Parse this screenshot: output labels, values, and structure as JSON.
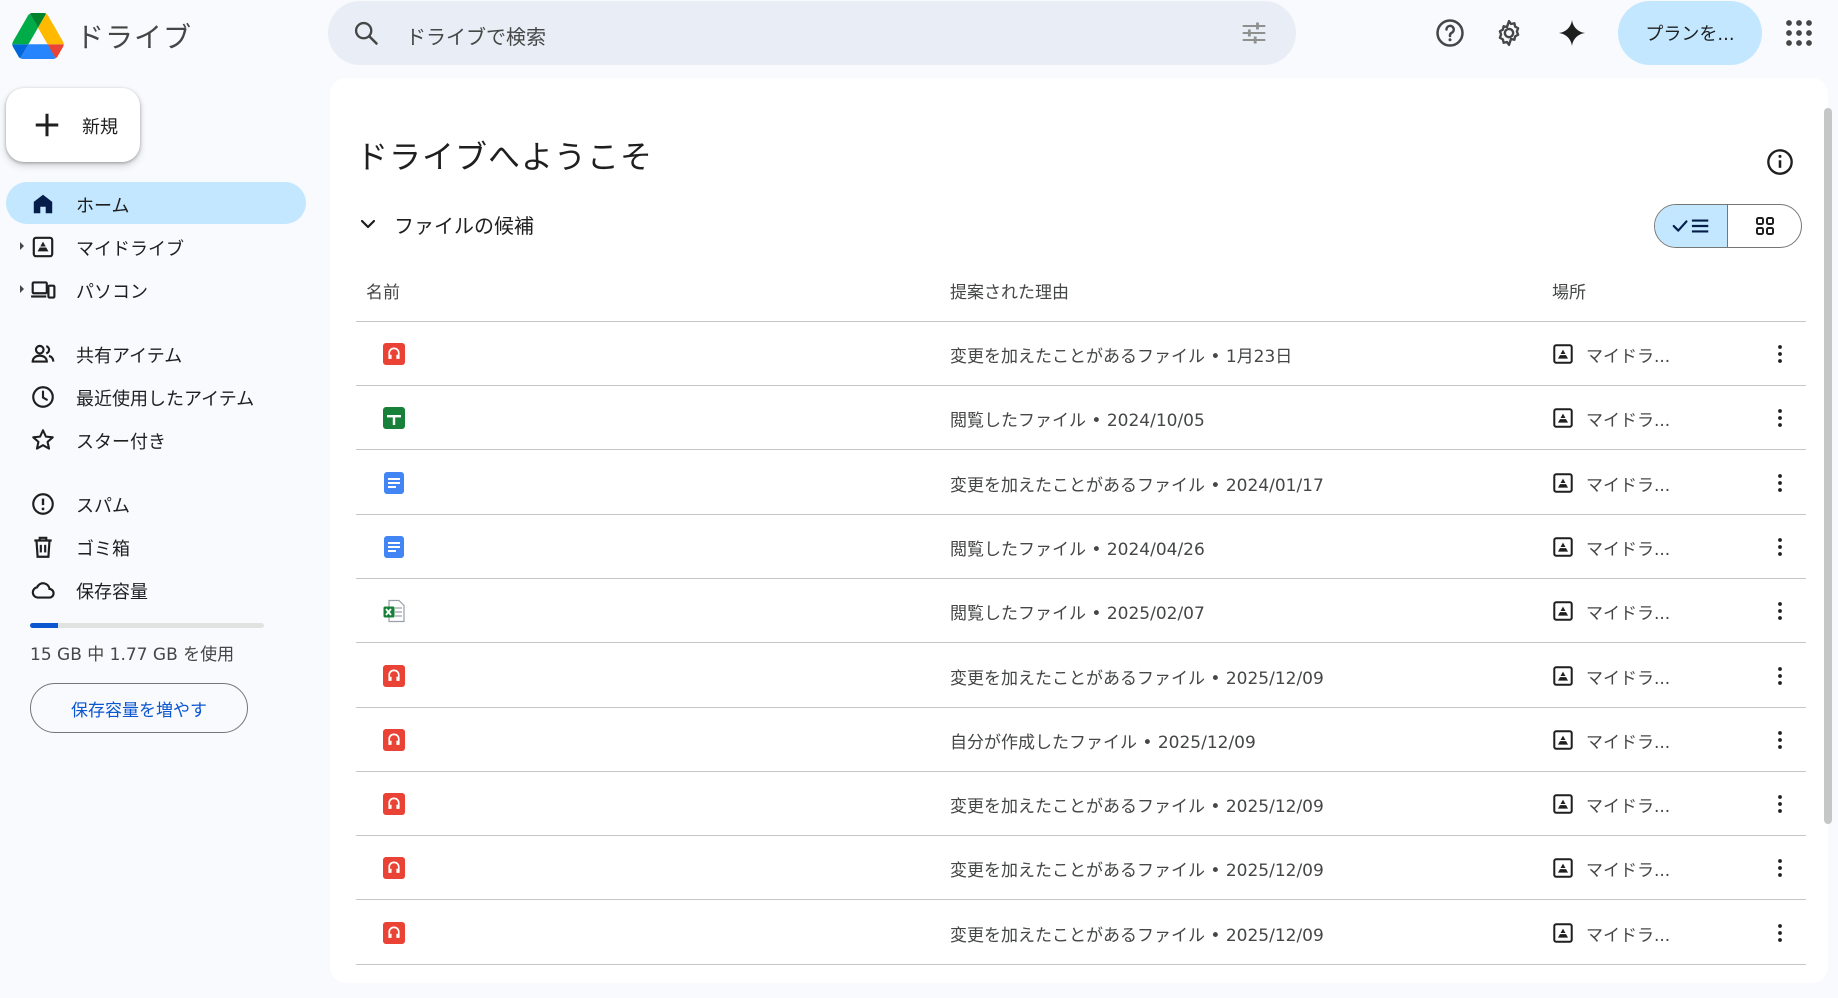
{
  "header": {
    "app_title": "ドライブ",
    "search_placeholder": "ドライブで検索",
    "plan_button": "プランを..."
  },
  "sidebar": {
    "new_label": "新規",
    "items": [
      {
        "label": "ホーム",
        "icon": "home-icon"
      },
      {
        "label": "マイドライブ",
        "icon": "my-drive-icon"
      },
      {
        "label": "パソコン",
        "icon": "computers-icon"
      },
      {
        "label": "共有アイテム",
        "icon": "shared-icon"
      },
      {
        "label": "最近使用したアイテム",
        "icon": "recent-icon"
      },
      {
        "label": "スター付き",
        "icon": "star-icon"
      },
      {
        "label": "スパム",
        "icon": "spam-icon"
      },
      {
        "label": "ゴミ箱",
        "icon": "trash-icon"
      },
      {
        "label": "保存容量",
        "icon": "cloud-icon"
      }
    ],
    "storage_used_fraction": 0.118,
    "storage_text": "15 GB 中 1.77 GB を使用",
    "storage_button": "保存容量を増やす"
  },
  "main": {
    "welcome_title": "ドライブへようこそ",
    "section_label": "ファイルの候補",
    "columns": {
      "name": "名前",
      "reason": "提案された理由",
      "location": "場所"
    },
    "rows": [
      {
        "type": "pdf",
        "reason": "変更を加えたことがあるファイル • 1月23日",
        "location": "マイドラ..."
      },
      {
        "type": "sheets",
        "reason": "閲覧したファイル • 2024/10/05",
        "location": "マイドラ..."
      },
      {
        "type": "docs",
        "reason": "変更を加えたことがあるファイル • 2024/01/17",
        "location": "マイドラ..."
      },
      {
        "type": "docs",
        "reason": "閲覧したファイル • 2024/04/26",
        "location": "マイドラ..."
      },
      {
        "type": "excel",
        "reason": "閲覧したファイル • 2025/02/07",
        "location": "マイドラ..."
      },
      {
        "type": "pdf",
        "reason": "変更を加えたことがあるファイル • 2025/12/09",
        "location": "マイドラ..."
      },
      {
        "type": "pdf",
        "reason": "自分が作成したファイル • 2025/12/09",
        "location": "マイドラ..."
      },
      {
        "type": "pdf",
        "reason": "変更を加えたことがあるファイル • 2025/12/09",
        "location": "マイドラ..."
      },
      {
        "type": "pdf",
        "reason": "変更を加えたことがあるファイル • 2025/12/09",
        "location": "マイドラ..."
      },
      {
        "type": "pdf",
        "reason": "変更を加えたことがあるファイル • 2025/12/09",
        "location": "マイドラ..."
      }
    ]
  },
  "colors": {
    "accent": "#0b57d0",
    "active_nav": "#c2e7ff",
    "pdf_red": "#ea4335",
    "sheets_green": "#188038",
    "docs_blue": "#4285f4"
  }
}
